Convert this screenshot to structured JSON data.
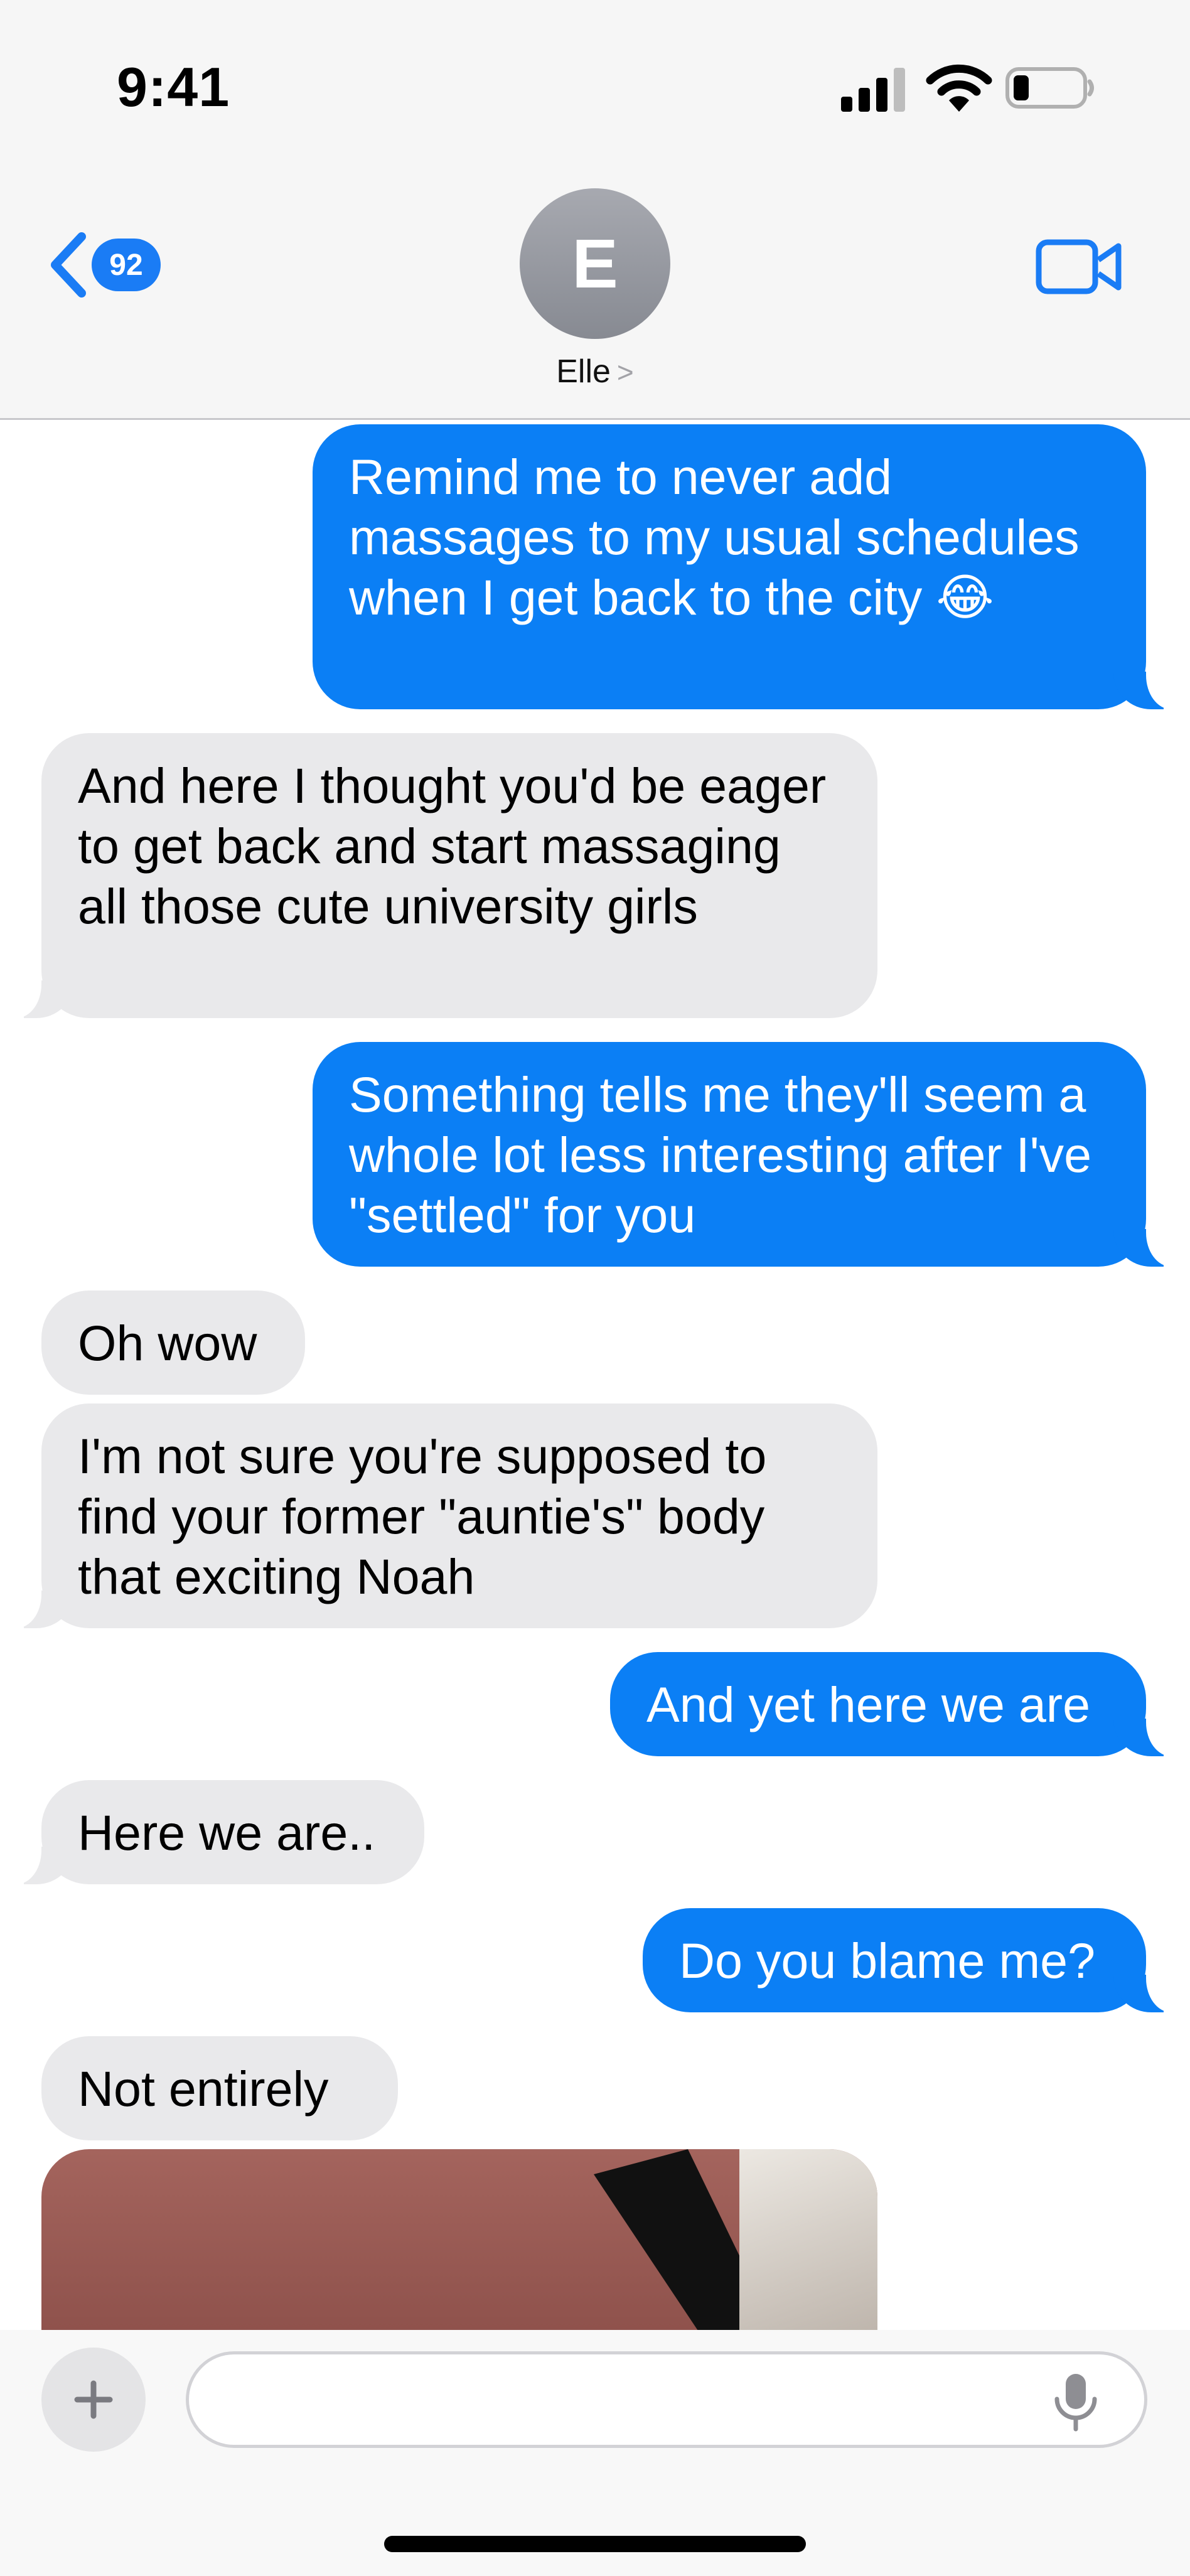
{
  "status_bar": {
    "time": "9:41",
    "icons": [
      "signal-icon",
      "wifi-icon",
      "battery-icon"
    ]
  },
  "header": {
    "back_badge": "92",
    "avatar_letter": "E",
    "contact_name": "Elle",
    "icons": [
      "back-chevron-icon",
      "chevron-right-icon",
      "video-camera-icon"
    ]
  },
  "messages": [
    {
      "from": "me",
      "text": "Remind me to never add massages to my usual schedules when I get back to the city 😂"
    },
    {
      "from": "them",
      "text": "And here I thought you'd be eager to get back and start massaging all those cute university girls"
    },
    {
      "from": "me",
      "text": "Something tells me they'll seem a whole lot less interesting after I've \"settled\" for you"
    },
    {
      "from": "them",
      "text": "Oh wow"
    },
    {
      "from": "them",
      "text": "I'm not sure you're supposed to find your former \"auntie's\" body that exciting Noah"
    },
    {
      "from": "me",
      "text": "And yet here we are"
    },
    {
      "from": "them",
      "text": "Here we are.."
    },
    {
      "from": "me",
      "text": "Do you blame me?"
    },
    {
      "from": "them",
      "text": "Not entirely"
    },
    {
      "from": "them",
      "type": "photo"
    }
  ],
  "composer": {
    "placeholder": "",
    "icons": [
      "plus-icon",
      "microphone-icon"
    ]
  },
  "colors": {
    "sent_bubble": "#0b7ff5",
    "received_bubble": "#e9e9eb",
    "badge": "#1a7cf5"
  }
}
